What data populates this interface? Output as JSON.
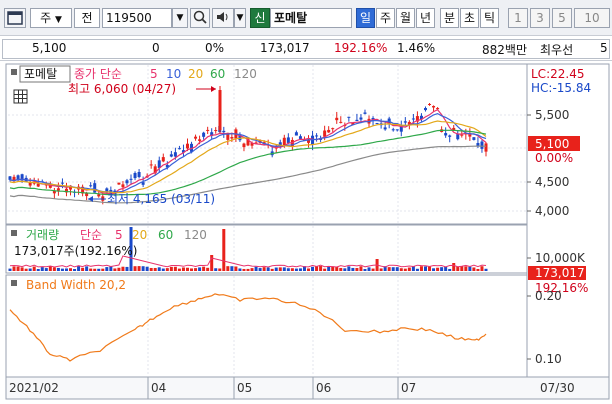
{
  "toolbar": {
    "market_label": "주",
    "period_label": "전",
    "code_value": "119500",
    "stock_name": "포메탈",
    "new_badge": "신",
    "period_buttons": [
      "일",
      "주",
      "월",
      "년",
      "분",
      "초",
      "틱"
    ],
    "active_period": "일",
    "number_buttons": [
      "1",
      "3",
      "5",
      "10"
    ]
  },
  "quote": {
    "price": "5,100",
    "change": "0",
    "change_rate": "0%",
    "volume": "173,017",
    "volume_ratio": "192.16%",
    "turnover_rate": "1.46%",
    "trade_amount": "882백만",
    "investor": "최우선",
    "investor_value": "5"
  },
  "price_panel": {
    "stock_name": "포메탈",
    "legend_label": "종가 단순",
    "ma_periods": [
      "5",
      "10",
      "20",
      "60",
      "120"
    ],
    "ma_colors": [
      "#e8336d",
      "#3a61d8",
      "#e3a81a",
      "#2fa84a",
      "#8a8a8a"
    ],
    "high_annotation": "최고 6,060 (04/27)",
    "low_annotation": "최저 4,165 (03/11)",
    "lc_label": "LC:22.45",
    "hc_label": "HC:-15.84",
    "y_ticks": [
      "5,500",
      "5,000",
      "4,500",
      "4,000"
    ],
    "current_price": "5,100",
    "current_change": "0.00%"
  },
  "volume_panel": {
    "legend_label": "거래량",
    "ma_label": "단순",
    "ma_periods": [
      "5",
      "20",
      "60",
      "120"
    ],
    "info": "173,017주(192.16%)",
    "y_tick": "10,000K",
    "current_volume": "173,017",
    "current_ratio": "192.16%"
  },
  "band_panel": {
    "legend_label": "Band Width 20,2",
    "y_ticks": [
      "0.20",
      "0.10"
    ]
  },
  "x_axis": {
    "labels": [
      "2021/02",
      "04",
      "05",
      "06",
      "07"
    ],
    "current_date": "07/30"
  }
}
